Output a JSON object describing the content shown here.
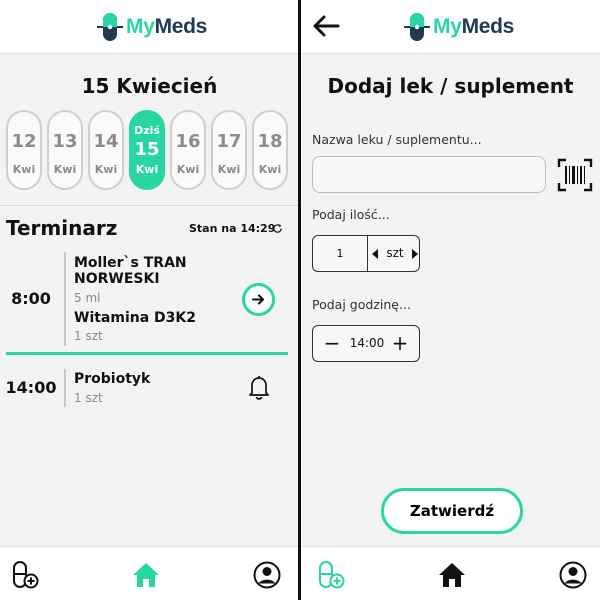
{
  "app": {
    "name_part1": "My",
    "name_part2": "Meds"
  },
  "colors": {
    "accent": "#27d6a3",
    "brand_dark": "#1f3a52"
  },
  "schedule_screen": {
    "date_title": "15 Kwiecień",
    "days": [
      {
        "num": "12",
        "month": "Kwi",
        "today": false
      },
      {
        "num": "13",
        "month": "Kwi",
        "today": false
      },
      {
        "num": "14",
        "month": "Kwi",
        "today": false
      },
      {
        "num": "15",
        "month": "Kwi",
        "today": true,
        "today_label": "Dziś"
      },
      {
        "num": "16",
        "month": "Kwi",
        "today": false
      },
      {
        "num": "17",
        "month": "Kwi",
        "today": false
      },
      {
        "num": "18",
        "month": "Kwi",
        "today": false
      }
    ],
    "section_title": "Terminarz",
    "status_text": "Stan na 14:29",
    "entries": [
      {
        "time": "8:00",
        "meds": [
          {
            "name": "Moller`s TRAN NORWESKI",
            "qty": "5 ml"
          },
          {
            "name": "Witamina D3K2",
            "qty": "1 szt"
          }
        ],
        "action_icon": "arrow-right-circle-icon"
      },
      {
        "time": "14:00",
        "meds": [
          {
            "name": "Probiotyk",
            "qty": "1 szt"
          }
        ],
        "action_icon": "bell-icon"
      }
    ]
  },
  "add_screen": {
    "title": "Dodaj lek / suplement",
    "name_label": "Nazwa leku / suplementu...",
    "name_value": "",
    "qty_label": "Podaj ilość...",
    "qty_value": "1",
    "qty_unit": "szt",
    "time_label": "Podaj godzinę...",
    "time_value": "14:00",
    "submit_label": "Zatwierdź"
  },
  "bottom_nav": [
    {
      "icon": "add-pill-icon",
      "active": false
    },
    {
      "icon": "home-icon",
      "active": true
    },
    {
      "icon": "profile-icon",
      "active": false
    }
  ]
}
